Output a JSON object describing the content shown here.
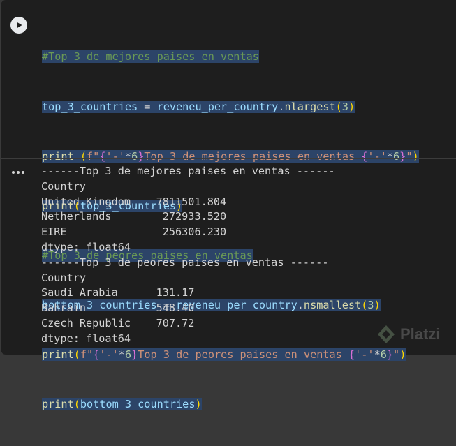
{
  "code_lines": [
    [
      "#Top 3 de mejores paises en ventas"
    ],
    [
      "top_3_countries",
      " = ",
      "reveneu_per_country",
      ".",
      "nlargest",
      "(",
      "3",
      ")"
    ],
    [
      "print",
      " (",
      "f\"",
      "{",
      "'-'",
      "*",
      "6",
      "}",
      "Top 3 de mejores paises en ventas ",
      "{",
      "'-'",
      "*",
      "6",
      "}",
      "\"",
      ")"
    ],
    [
      "print",
      "(",
      "top_3_countries",
      ")"
    ],
    [
      "#Top 3 de peores paises en ventas"
    ],
    [
      "bottom_3_countries",
      " = ",
      "reveneu_per_country",
      ".",
      "nsmallest",
      "(",
      "3",
      ")"
    ],
    [
      "print",
      "(",
      "f\"",
      "{",
      "'-'",
      "*",
      "6",
      "}",
      "Top 3 de peores paises en ventas ",
      "{",
      "'-'",
      "*",
      "6",
      "}",
      "\"",
      ")"
    ],
    [
      "print",
      "(",
      "bottom_3_countries",
      ")"
    ]
  ],
  "output_lines": [
    "------Top 3 de mejores paises en ventas ------",
    "Country",
    "United Kingdom    7811501.804",
    "Netherlands        272933.520",
    "EIRE               256306.230",
    "dtype: float64",
    "------Top 3 de peores paises en ventas ------",
    "Country",
    "Saudi Arabia      131.17",
    "Bahrain           548.40",
    "Czech Republic    707.72",
    "dtype: float64"
  ],
  "watermark": "Platzi"
}
